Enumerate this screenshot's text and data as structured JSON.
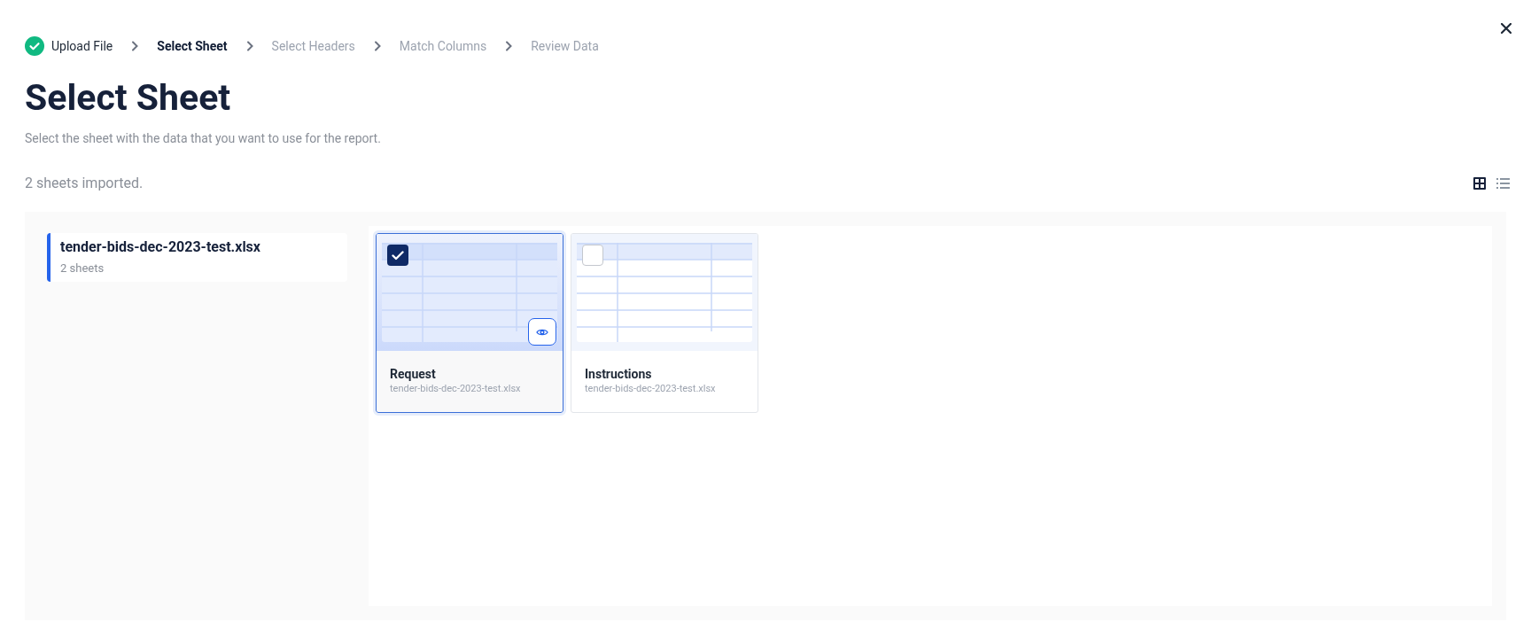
{
  "steps": [
    {
      "label": "Upload File",
      "done": true,
      "current": false
    },
    {
      "label": "Select Sheet",
      "done": false,
      "current": true
    },
    {
      "label": "Select Headers",
      "done": false,
      "current": false
    },
    {
      "label": "Match Columns",
      "done": false,
      "current": false
    },
    {
      "label": "Review Data",
      "done": false,
      "current": false
    }
  ],
  "title": "Select Sheet",
  "subtitle": "Select the sheet with the data that you want to use for the report.",
  "count": "2 sheets imported.",
  "view_toggle": [
    {
      "kind": "grid",
      "selected": true
    },
    {
      "kind": "list",
      "selected": false
    }
  ],
  "files": [
    {
      "name": "tender-bids-dec-2023-test.xlsx",
      "meta": "2 sheets",
      "selected": true
    }
  ],
  "sheets": [
    {
      "name": "Request",
      "file": "tender-bids-dec-2023-test.xlsx",
      "checked": true,
      "hovered": true
    },
    {
      "name": "Instructions",
      "file": "tender-bids-dec-2023-test.xlsx",
      "checked": false,
      "hovered": false
    }
  ]
}
